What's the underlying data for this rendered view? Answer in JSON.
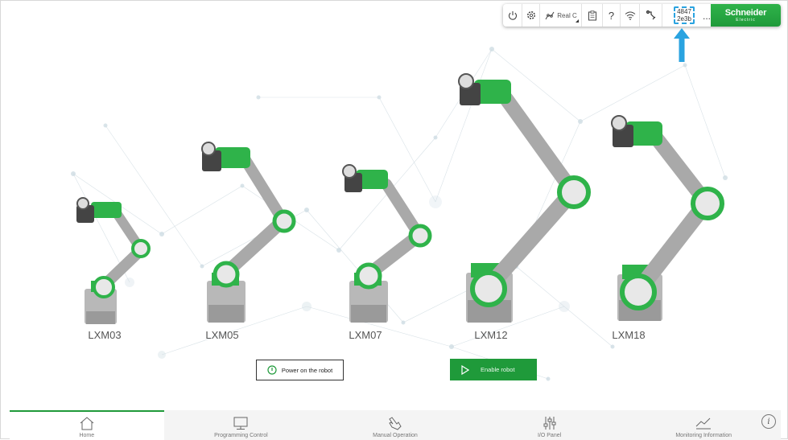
{
  "toolbar": {
    "mode_label": "Real C",
    "help_label": "?",
    "id_line1": "4847",
    "id_line2": "2e3b",
    "more_label": "...",
    "icons": [
      "power-icon",
      "settings-gear-icon",
      "robot-mode-icon",
      "clipboard-icon",
      "help-icon",
      "wifi-icon",
      "tool-icon"
    ]
  },
  "brand": {
    "name": "Schneider",
    "sub": "Electric"
  },
  "robots": [
    {
      "label": "LXM03"
    },
    {
      "label": "LXM05"
    },
    {
      "label": "LXM07"
    },
    {
      "label": "LXM12"
    },
    {
      "label": "LXM18"
    }
  ],
  "actions": {
    "power_on_label": "Power on the robot",
    "enable_label": "Enable robot"
  },
  "nav": {
    "items": [
      {
        "label": "Home",
        "icon": "home-icon",
        "active": true
      },
      {
        "label": "Programming Control",
        "icon": "monitor-icon",
        "active": false
      },
      {
        "label": "Manual Operation",
        "icon": "hand-pointer-icon",
        "active": false
      },
      {
        "label": "I/O Panel",
        "icon": "sliders-icon",
        "active": false
      },
      {
        "label": "Monitoring Information",
        "icon": "trend-chart-icon",
        "active": false
      }
    ],
    "info_label": "i"
  },
  "colors": {
    "accent_green": "#1f9a3a",
    "brand_green": "#2fb34a",
    "callout_blue": "#2aa3e0"
  }
}
